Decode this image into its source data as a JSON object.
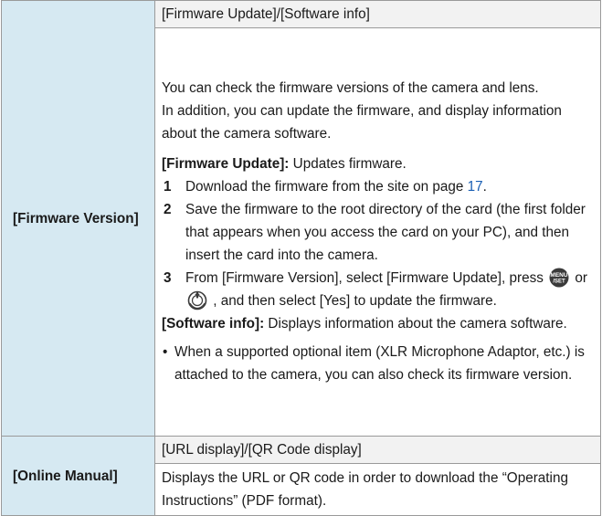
{
  "rows": {
    "firmware": {
      "label": "[Firmware Version]",
      "sub_header": "[Firmware Update]/[Software info]",
      "intro_1": "You can check the firmware versions of the camera and lens.",
      "intro_2": "In addition, you can update the firmware, and display information about the camera software.",
      "update_title": "[Firmware Update]:",
      "update_text": " Updates firmware.",
      "steps": [
        {
          "num": "1",
          "text_before": "Download the firmware from the site on page ",
          "link": "17",
          "text_after": "."
        },
        {
          "num": "2",
          "text": "Save the firmware to the root directory of the card (the first folder that appears when you access the card on your PC), and then insert the card into the camera."
        },
        {
          "num": "3",
          "text_a": "From [Firmware Version], select [Firmware Update], press",
          "or": "or",
          "text_b": ", and then select [Yes] to update the firmware.",
          "icon_a": "menu-set-button-icon",
          "icon_b": "control-dial-icon"
        }
      ],
      "software_title": "[Software info]:",
      "software_text": " Displays information about the camera software.",
      "bullet": "•",
      "note": "When a supported optional item (XLR Microphone Adaptor, etc.) is attached to the camera, you can also check its firmware version."
    },
    "manual": {
      "label": "[Online Manual]",
      "sub_header": "[URL display]/[QR Code display]",
      "desc": "Displays the URL or QR code in order to download the “Operating Instructions” (PDF format)."
    }
  }
}
